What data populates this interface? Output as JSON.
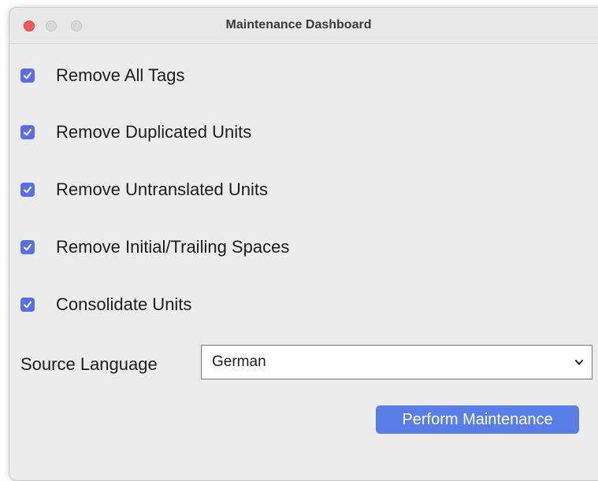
{
  "window": {
    "title": "Maintenance Dashboard"
  },
  "options": [
    {
      "label": "Remove All Tags",
      "checked": true
    },
    {
      "label": "Remove Duplicated Units",
      "checked": true
    },
    {
      "label": "Remove Untranslated Units",
      "checked": true
    },
    {
      "label": "Remove Initial/Trailing Spaces",
      "checked": true
    },
    {
      "label": "Consolidate Units",
      "checked": true
    }
  ],
  "source_language": {
    "label": "Source Language",
    "selected": "German"
  },
  "actions": {
    "perform_label": "Perform Maintenance"
  },
  "colors": {
    "accent": "#5a7ee8",
    "checkbox": "#5a6ee6",
    "close_button": "#ee5a55",
    "window_bg": "#ececec"
  }
}
